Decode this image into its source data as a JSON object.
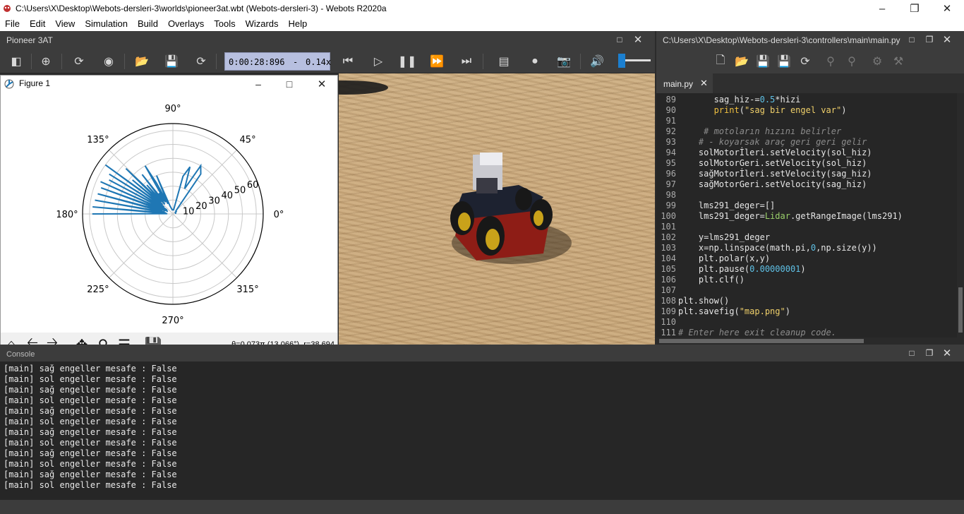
{
  "window": {
    "title": "C:\\Users\\X\\Desktop\\Webots-dersleri-3\\worlds\\pioneer3at.wbt (Webots-dersleri-3) - Webots R2020a"
  },
  "menu": [
    "File",
    "Edit",
    "View",
    "Simulation",
    "Build",
    "Overlays",
    "Tools",
    "Wizards",
    "Help"
  ],
  "scene": {
    "robot_name": "Pioneer 3AT",
    "time": "0:00:28:896",
    "dash": "-",
    "speed": "0.14x",
    "volume": 0.05
  },
  "figure": {
    "title": "Figure 1",
    "coord_readout": "θ=0.073π (13.066°), r=38.694"
  },
  "chart_data": {
    "type": "line",
    "projection": "polar",
    "angle_ticks": [
      "0°",
      "45°",
      "90°",
      "135°",
      "180°",
      "225°",
      "270°",
      "315°"
    ],
    "radial_ticks": [
      "10",
      "20",
      "30",
      "40",
      "50",
      "60"
    ],
    "rlim": [
      0,
      65
    ],
    "grid": true,
    "series": [
      {
        "color": "#1f77b4",
        "theta_deg": [
          180,
          177,
          175,
          172,
          170,
          168,
          165,
          163,
          160,
          158,
          156,
          154,
          152,
          150,
          148,
          146,
          144,
          142,
          140,
          138,
          136,
          134,
          132,
          130,
          128,
          126,
          124,
          122,
          120,
          118,
          116,
          113,
          110,
          105,
          100,
          95,
          90,
          85,
          80,
          75,
          70,
          65,
          60,
          55,
          50,
          45,
          40,
          35,
          30,
          25,
          20,
          15,
          10,
          5,
          0
        ],
        "r": [
          58,
          4,
          58,
          5,
          57,
          6,
          56,
          8,
          55,
          6,
          57,
          4,
          52,
          6,
          54,
          5,
          60,
          8,
          38,
          10,
          47,
          12,
          28,
          9,
          36,
          11,
          18,
          10,
          40,
          25,
          8,
          30,
          6,
          4,
          3,
          3,
          3,
          3,
          3,
          28,
          36,
          20,
          40,
          35,
          5,
          3,
          3,
          3,
          2,
          2,
          2,
          2,
          2,
          2,
          2
        ]
      }
    ]
  },
  "editor": {
    "path": "C:\\Users\\X\\Desktop\\Webots-dersleri-3\\controllers\\main\\main.py",
    "tab": "main.py",
    "lines": [
      {
        "n": "89",
        "html": "       sag_hiz-=<span class='num'>0.5</span>*hizi"
      },
      {
        "n": "90",
        "html": "       <span class='kw'>print</span>(<span class='str'>\"sag bir engel var\"</span>)"
      },
      {
        "n": "91",
        "html": ""
      },
      {
        "n": "92",
        "html": "     <span class='cm'># motoların hızını belirler</span>"
      },
      {
        "n": "93",
        "html": "    <span class='cm'># - koyarsak araç geri geri gelir</span>"
      },
      {
        "n": "94",
        "html": "    solMotorİleri.setVelocity(sol_hiz)"
      },
      {
        "n": "95",
        "html": "    solMotorGeri.setVelocity(sol_hiz)"
      },
      {
        "n": "96",
        "html": "    sağMotorİleri.setVelocity(sag_hiz)"
      },
      {
        "n": "97",
        "html": "    sağMotorGeri.setVelocity(sag_hiz)"
      },
      {
        "n": "98",
        "html": ""
      },
      {
        "n": "99",
        "html": "    lms291_deger=[]"
      },
      {
        "n": "100",
        "html": "    lms291_deger=<span class='fn'>Lidar</span>.getRangeImage(lms291)"
      },
      {
        "n": "101",
        "html": ""
      },
      {
        "n": "102",
        "html": "    y=lms291_deger"
      },
      {
        "n": "103",
        "html": "    x=np.linspace(math.pi,<span class='num'>0</span>,np.size(y))"
      },
      {
        "n": "104",
        "html": "    plt.polar(x,y)"
      },
      {
        "n": "105",
        "html": "    plt.pause(<span class='num'>0.00000001</span>)"
      },
      {
        "n": "106",
        "html": "    plt.clf()"
      },
      {
        "n": "107",
        "html": ""
      },
      {
        "n": "108",
        "html": "plt.show()"
      },
      {
        "n": "109",
        "html": "plt.savefig(<span class='str'>\"map.png\"</span>)"
      },
      {
        "n": "110",
        "html": ""
      },
      {
        "n": "111",
        "html": "<span class='cm'># Enter here exit cleanup code.</span>"
      }
    ]
  },
  "console": {
    "label": "Console",
    "lines": [
      "[main] sağ engeller mesafe : False",
      "[main] sol engeller mesafe : False",
      "[main] sağ engeller mesafe : False",
      "[main] sol engeller mesafe : False",
      "[main] sağ engeller mesafe : False",
      "[main] sol engeller mesafe : False",
      "[main] sağ engeller mesafe : False",
      "[main] sol engeller mesafe : False",
      "[main] sağ engeller mesafe : False",
      "[main] sol engeller mesafe : False",
      "[main] sağ engeller mesafe : False",
      "[main] sol engeller mesafe : False"
    ]
  }
}
